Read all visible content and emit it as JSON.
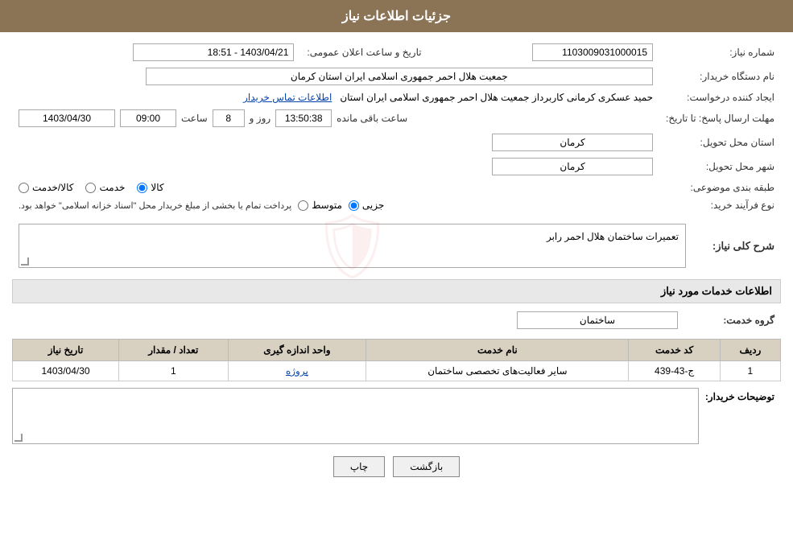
{
  "header": {
    "title": "جزئیات اطلاعات نیاز"
  },
  "info": {
    "need_number_label": "شماره نیاز:",
    "need_number_value": "1103009031000015",
    "date_label": "تاریخ و ساعت اعلان عمومی:",
    "date_value": "1403/04/21 - 18:51",
    "buyer_name_label": "نام دستگاه خریدار:",
    "buyer_name_value": "جمعیت هلال احمر جمهوری اسلامی ایران استان کرمان",
    "creator_label": "ایجاد کننده درخواست:",
    "creator_name": "حمید عسکری کرمانی کاربرداز جمعیت هلال احمر جمهوری اسلامی ایران استان",
    "creator_link": "اطلاعات تماس خریدار",
    "deadline_label": "مهلت ارسال پاسخ: تا تاریخ:",
    "deadline_date": "1403/04/30",
    "deadline_time_label": "ساعت",
    "deadline_time": "09:00",
    "deadline_days_label": "روز و",
    "deadline_days": "8",
    "deadline_remaining_label": "ساعت باقی مانده",
    "deadline_remaining": "13:50:38",
    "province_label": "استان محل تحویل:",
    "province_value": "کرمان",
    "city_label": "شهر محل تحویل:",
    "city_value": "کرمان",
    "category_label": "طبقه بندی موضوعی:",
    "category_kala": "کالا",
    "category_khadamat": "خدمت",
    "category_kala_khadamat": "کالا/خدمت",
    "process_label": "نوع فرآیند خرید:",
    "process_jazii": "جزیی",
    "process_motavaset": "متوسط",
    "process_desc": "پرداخت تمام یا بخشی از مبلغ خریدار محل \"اسناد خزانه اسلامی\" خواهد بود.",
    "need_desc_label": "شرح کلی نیاز:",
    "need_desc_value": "تعمیرات ساختمان هلال احمر رابر"
  },
  "services_section": {
    "title": "اطلاعات خدمات مورد نیاز",
    "service_group_label": "گروه خدمت:",
    "service_group_value": "ساختمان",
    "table_headers": {
      "row_num": "ردیف",
      "service_code": "کد خدمت",
      "service_name": "نام خدمت",
      "unit": "واحد اندازه گیری",
      "quantity": "تعداد / مقدار",
      "date": "تاریخ نیاز"
    },
    "table_rows": [
      {
        "row_num": "1",
        "service_code": "ج-43-439",
        "service_name": "سایر فعالیت‌های تخصصی ساختمان",
        "unit": "پروژه",
        "quantity": "1",
        "date": "1403/04/30"
      }
    ]
  },
  "buyer_desc": {
    "label": "توضیحات خریدار:",
    "value": ""
  },
  "buttons": {
    "print": "چاپ",
    "back": "بازگشت"
  }
}
